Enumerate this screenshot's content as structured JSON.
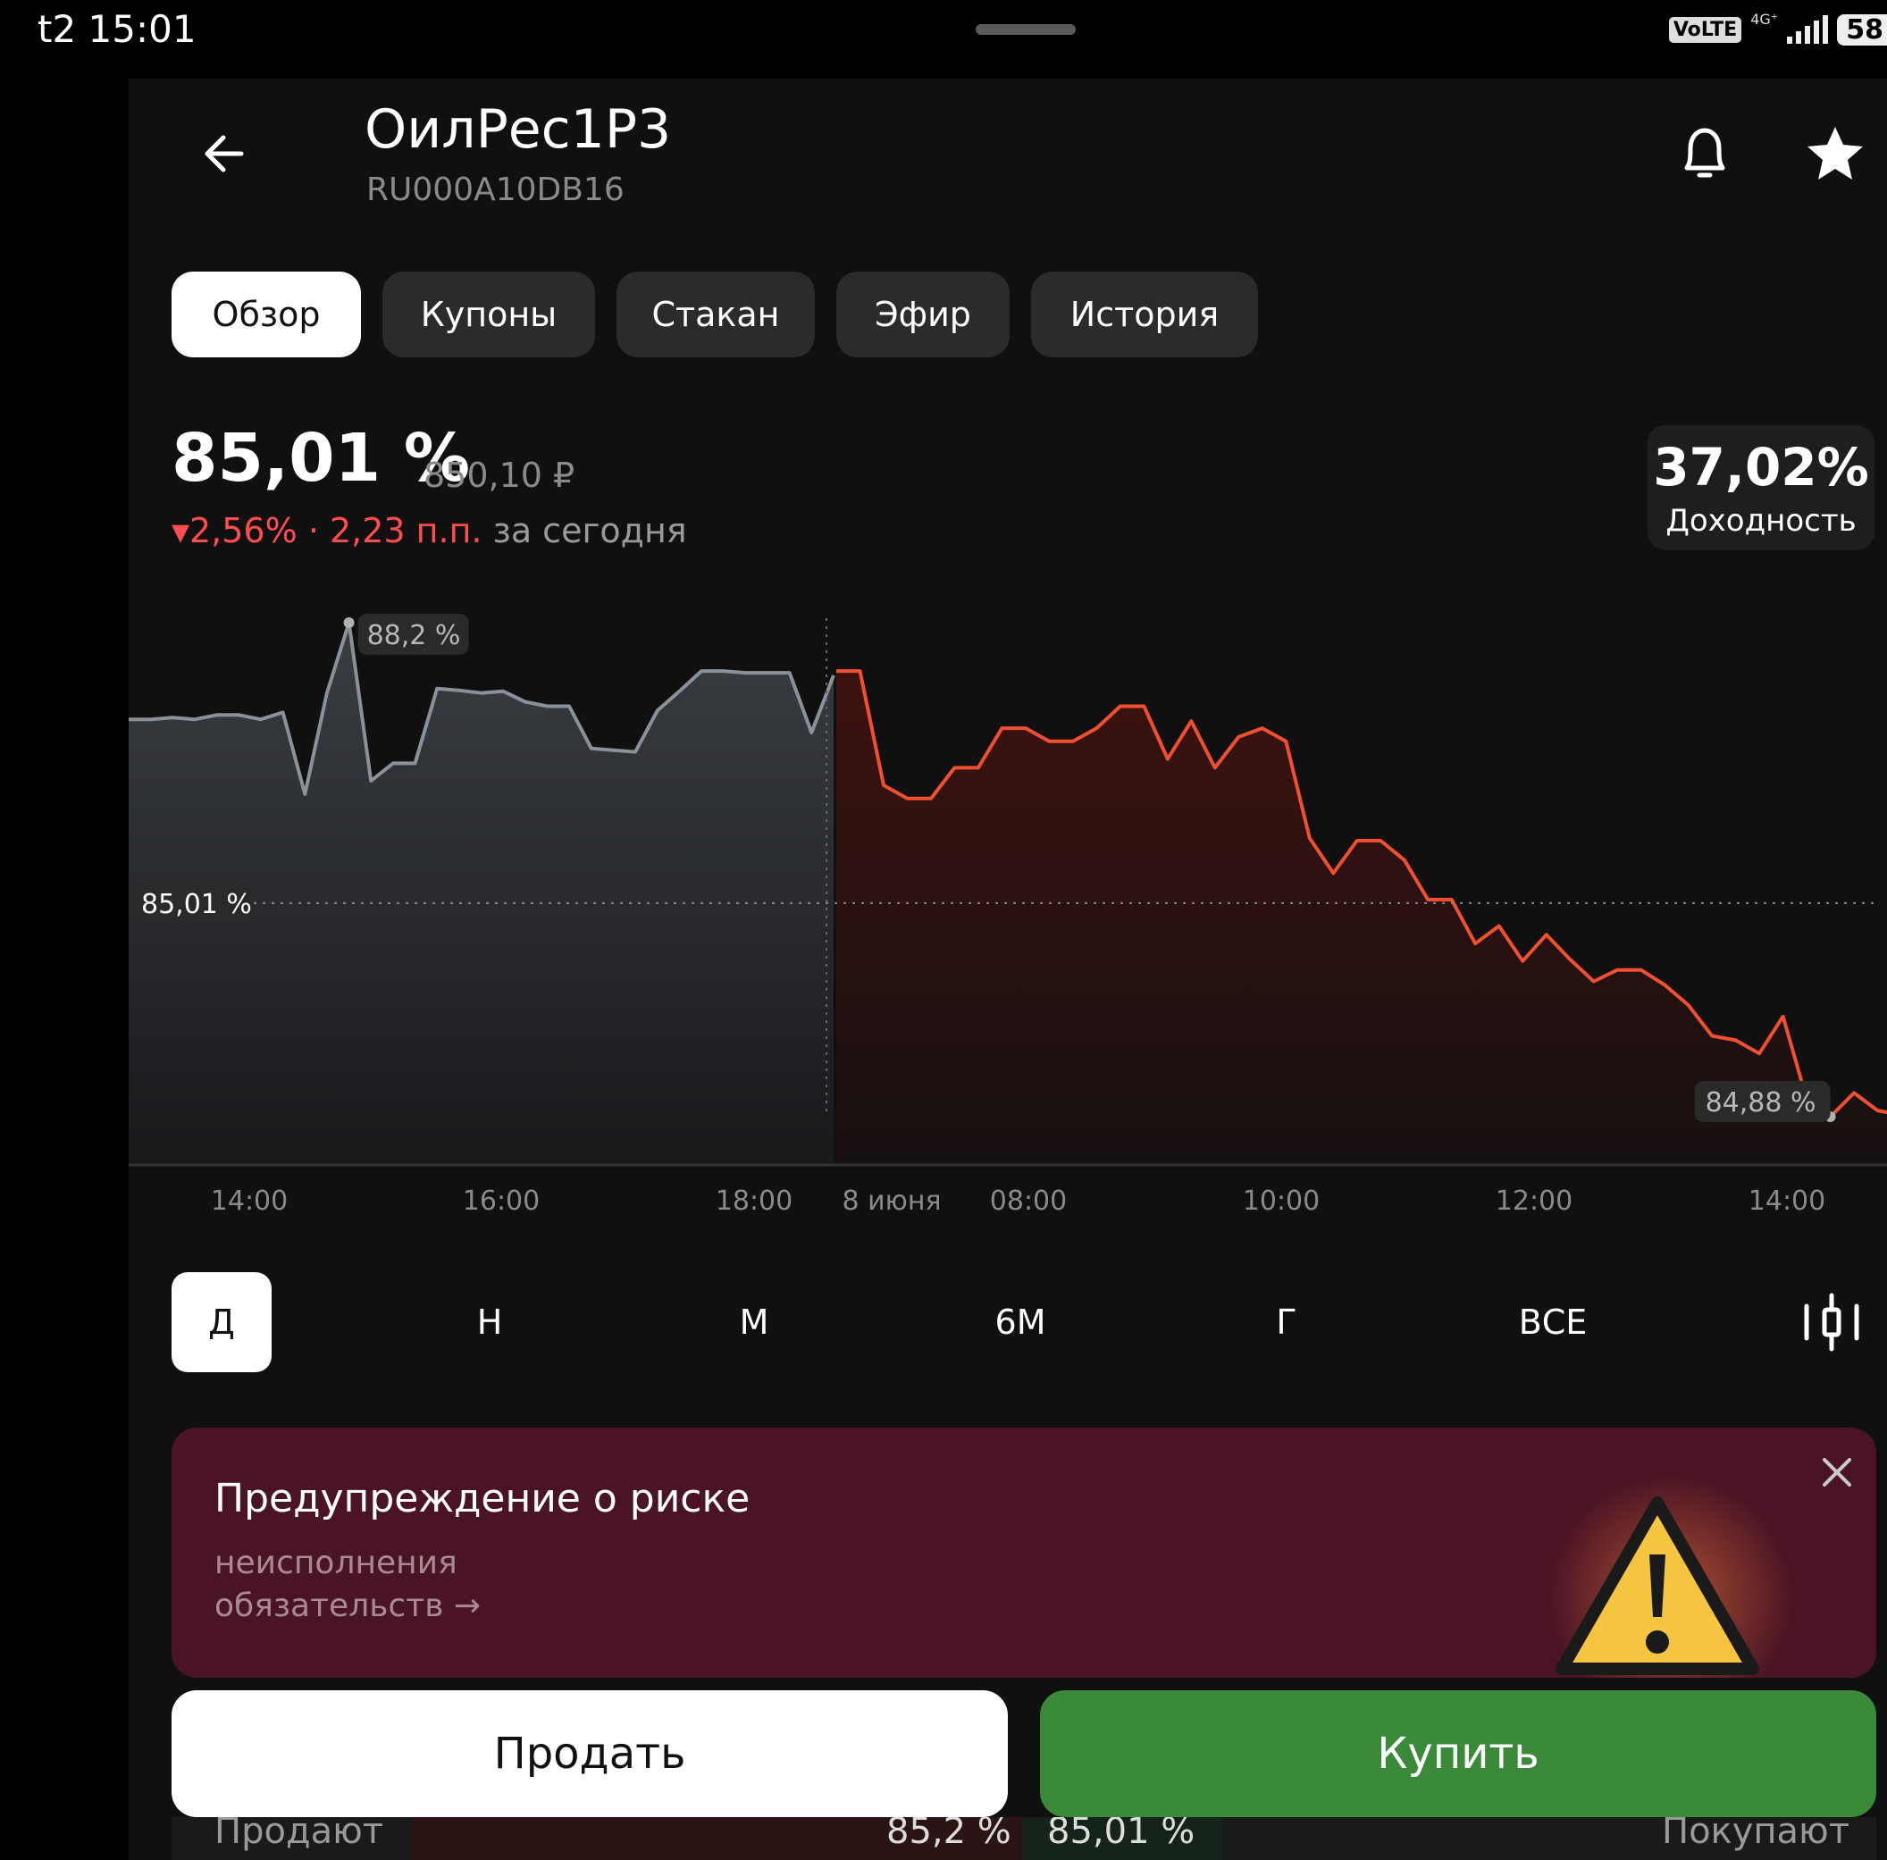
{
  "status_bar": {
    "time": "t2 15:01",
    "volte": "VoLTE",
    "network": "4G⁺",
    "battery": "58"
  },
  "header": {
    "title": "ОилРес1Р3",
    "isin": "RU000A10DB16"
  },
  "tabs": [
    {
      "label": "Обзор",
      "active": true
    },
    {
      "label": "Купоны",
      "active": false
    },
    {
      "label": "Стакан",
      "active": false
    },
    {
      "label": "Эфир",
      "active": false
    },
    {
      "label": "История",
      "active": false
    }
  ],
  "price": {
    "percent": "85,01 %",
    "rub": "850,10 ₽",
    "change_percent": "2,56%",
    "change_pp": "· 2,23 п.п.",
    "change_label": "за сегодня"
  },
  "yield": {
    "value": "37,02%",
    "label": "Доходность"
  },
  "chart_data": {
    "type": "area",
    "x_ticks": [
      "14:00",
      "16:00",
      "18:00",
      "8 июня",
      "08:00",
      "10:00",
      "12:00",
      "14:00"
    ],
    "max_label": "88,2 %",
    "min_label": "84,88 %",
    "current_label": "85,01 %",
    "current_value": 85.01,
    "series": [
      {
        "values": [
          87.1,
          87.1,
          87.12,
          87.1,
          87.15,
          87.15,
          87.1,
          87.18,
          86.25,
          87.4,
          88.2,
          86.4,
          86.6,
          86.6,
          87.45,
          87.43,
          87.4,
          87.42,
          87.3,
          87.25,
          87.25,
          86.77,
          86.75,
          86.73,
          87.2,
          87.42,
          87.65,
          87.65,
          87.63,
          87.63,
          87.63,
          86.95,
          87.6
        ]
      },
      {
        "values": [
          87.65,
          87.65,
          86.35,
          86.2,
          86.2,
          86.55,
          86.55,
          87.0,
          87.0,
          86.85,
          86.85,
          87.0,
          87.25,
          87.25,
          86.65,
          87.08,
          86.55,
          86.9,
          87.0,
          86.85,
          85.75,
          85.35,
          85.72,
          85.72,
          85.5,
          85.05,
          85.05,
          84.55,
          84.75,
          84.35,
          84.65,
          84.37,
          84.12,
          84.25,
          84.25,
          84.08,
          83.85,
          83.5,
          83.45,
          83.3,
          83.72,
          82.78,
          82.58,
          82.85,
          82.65,
          82.6,
          82.85,
          82.6,
          82.78,
          82.62
        ]
      }
    ]
  },
  "periods": [
    {
      "label": "Д",
      "active": true
    },
    {
      "label": "Н",
      "active": false
    },
    {
      "label": "М",
      "active": false
    },
    {
      "label": "6М",
      "active": false
    },
    {
      "label": "Г",
      "active": false
    },
    {
      "label": "ВСЕ",
      "active": false
    }
  ],
  "icons": {
    "chart_type": "candlestick-icon",
    "back": "arrow-left-icon",
    "bell": "bell-icon",
    "star": "star-icon"
  },
  "warning": {
    "title": "Предупреждение о риске",
    "line1": "неисполнения",
    "line2": "обязательств →"
  },
  "actions": {
    "sell": "Продать",
    "buy": "Купить"
  },
  "orderbook": {
    "sellers_label": "Продают",
    "ask": "85,2 %",
    "bid": "85,01 %",
    "buyers_label": "Покупают"
  },
  "colors": {
    "up": "#3a8a3a",
    "down": "#ff4d4d",
    "warning_bg": "#4b1424"
  }
}
